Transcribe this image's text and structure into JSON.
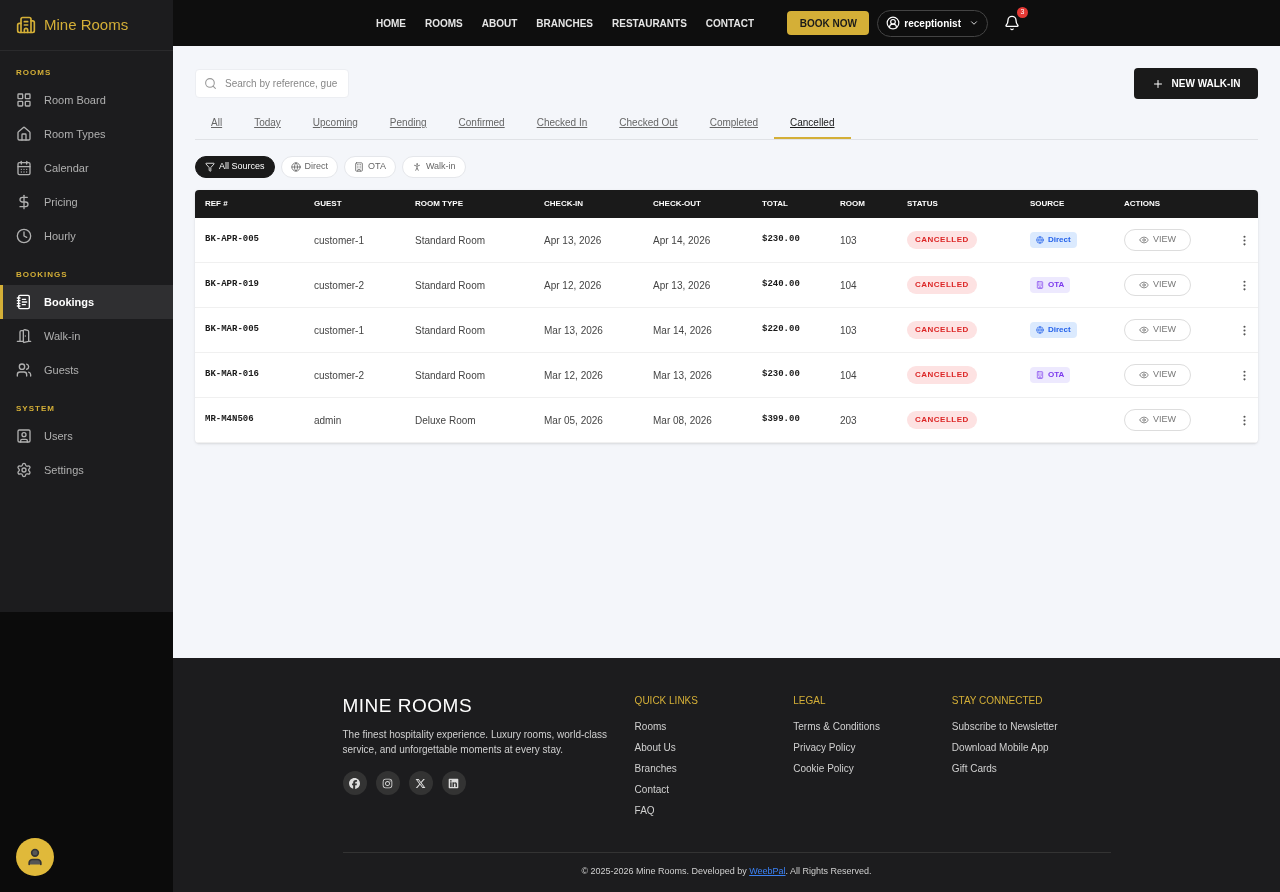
{
  "brand": "Mine Rooms",
  "sidebar": [
    {
      "heading": "ROOMS",
      "items": [
        {
          "label": "Room Board",
          "selected": false
        },
        {
          "label": "Room Types",
          "selected": false
        },
        {
          "label": "Calendar",
          "selected": false
        },
        {
          "label": "Pricing",
          "selected": false
        },
        {
          "label": "Hourly",
          "selected": false
        }
      ]
    },
    {
      "heading": "BOOKINGS",
      "items": [
        {
          "label": "Bookings",
          "selected": true
        },
        {
          "label": "Walk-in",
          "selected": false
        },
        {
          "label": "Guests",
          "selected": false
        }
      ]
    },
    {
      "heading": "SYSTEM",
      "items": [
        {
          "label": "Users",
          "selected": false
        },
        {
          "label": "Settings",
          "selected": false
        }
      ]
    }
  ],
  "nav": [
    "HOME",
    "ROOMS",
    "ABOUT",
    "BRANCHES",
    "RESTAURANTS",
    "CONTACT"
  ],
  "book_now": "BOOK NOW",
  "user": "receptionist",
  "notifications": "3",
  "search": {
    "placeholder": "Search by reference, gue"
  },
  "new_walkin": "NEW WALK-IN",
  "tabs": [
    {
      "label": "All",
      "selected": false
    },
    {
      "label": "Today",
      "selected": false
    },
    {
      "label": "Upcoming",
      "selected": false
    },
    {
      "label": "Pending",
      "selected": false
    },
    {
      "label": "Confirmed",
      "selected": false
    },
    {
      "label": "Checked In",
      "selected": false
    },
    {
      "label": "Checked Out",
      "selected": false
    },
    {
      "label": "Completed",
      "selected": false
    },
    {
      "label": "Cancelled",
      "selected": true
    }
  ],
  "sources": [
    {
      "kind": "all",
      "label": "All Sources",
      "selected": true
    },
    {
      "kind": "direct",
      "label": "Direct",
      "selected": false
    },
    {
      "kind": "ota",
      "label": "OTA",
      "selected": false
    },
    {
      "kind": "walkin",
      "label": "Walk-in",
      "selected": false
    }
  ],
  "table": {
    "columns": [
      "REF #",
      "GUEST",
      "ROOM TYPE",
      "CHECK-IN",
      "CHECK-OUT",
      "TOTAL",
      "ROOM",
      "STATUS",
      "SOURCE",
      "ACTIONS"
    ],
    "rows": [
      {
        "ref": "BK-APR-005",
        "guest": "customer-1",
        "room_type": "Standard Room",
        "check_in": "Apr 13, 2026",
        "check_out": "Apr 14, 2026",
        "total": "$230.00",
        "room": "103",
        "status": "CANCELLED",
        "source": {
          "kind": "direct",
          "label": "Direct"
        },
        "action": "VIEW"
      },
      {
        "ref": "BK-APR-019",
        "guest": "customer-2",
        "room_type": "Standard Room",
        "check_in": "Apr 12, 2026",
        "check_out": "Apr 13, 2026",
        "total": "$240.00",
        "room": "104",
        "status": "CANCELLED",
        "source": {
          "kind": "ota",
          "label": "OTA"
        },
        "action": "VIEW"
      },
      {
        "ref": "BK-MAR-005",
        "guest": "customer-1",
        "room_type": "Standard Room",
        "check_in": "Mar 13, 2026",
        "check_out": "Mar 14, 2026",
        "total": "$220.00",
        "room": "103",
        "status": "CANCELLED",
        "source": {
          "kind": "direct",
          "label": "Direct"
        },
        "action": "VIEW"
      },
      {
        "ref": "BK-MAR-016",
        "guest": "customer-2",
        "room_type": "Standard Room",
        "check_in": "Mar 12, 2026",
        "check_out": "Mar 13, 2026",
        "total": "$230.00",
        "room": "104",
        "status": "CANCELLED",
        "source": {
          "kind": "ota",
          "label": "OTA"
        },
        "action": "VIEW"
      },
      {
        "ref": "MR-M4N506",
        "guest": "admin",
        "room_type": "Deluxe Room",
        "check_in": "Mar 05, 2026",
        "check_out": "Mar 08, 2026",
        "total": "$399.00",
        "room": "203",
        "status": "CANCELLED",
        "action": "VIEW"
      }
    ]
  },
  "footer": {
    "brand": "MINE ROOMS",
    "tagline": "The finest hospitality experience. Luxury rooms, world-class service, and unforgettable moments at every stay.",
    "columns": [
      {
        "heading": "QUICK LINKS",
        "links": [
          "Rooms",
          "About Us",
          "Branches",
          "Contact",
          "FAQ"
        ]
      },
      {
        "heading": "LEGAL",
        "links": [
          "Terms & Conditions",
          "Privacy Policy",
          "Cookie Policy"
        ]
      },
      {
        "heading": "STAY CONNECTED",
        "links": [
          "Subscribe to Newsletter",
          "Download Mobile App",
          "Gift Cards"
        ]
      }
    ],
    "copyright_before": "© 2025-2026 Mine Rooms. Developed by",
    "developer": "WeebPal",
    "copyright_after": ". All Rights Reserved."
  }
}
